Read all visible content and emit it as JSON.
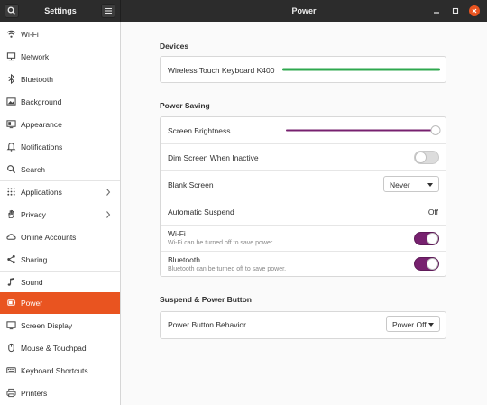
{
  "header": {
    "sidebar_title": "Settings",
    "main_title": "Power",
    "accent_close": "#e95420"
  },
  "sidebar": {
    "active": "Power",
    "active_color": "#e95420",
    "items": [
      {
        "label": "Wi-Fi",
        "icon": "wifi-icon"
      },
      {
        "label": "Network",
        "icon": "network-icon"
      },
      {
        "label": "Bluetooth",
        "icon": "bluetooth-icon"
      },
      {
        "label": "Background",
        "icon": "background-icon"
      },
      {
        "label": "Appearance",
        "icon": "appearance-icon"
      },
      {
        "label": "Notifications",
        "icon": "bell-icon"
      },
      {
        "label": "Search",
        "icon": "search-icon"
      },
      {
        "label": "Applications",
        "icon": "apps-icon",
        "chevron": true
      },
      {
        "label": "Privacy",
        "icon": "hand-icon",
        "chevron": true
      },
      {
        "label": "Online Accounts",
        "icon": "cloud-icon"
      },
      {
        "label": "Sharing",
        "icon": "share-icon"
      },
      {
        "label": "Sound",
        "icon": "music-icon"
      },
      {
        "label": "Power",
        "icon": "power-icon"
      },
      {
        "label": "Screen Display",
        "icon": "display-icon"
      },
      {
        "label": "Mouse & Touchpad",
        "icon": "mouse-icon"
      },
      {
        "label": "Keyboard Shortcuts",
        "icon": "keyboard-icon"
      },
      {
        "label": "Printers",
        "icon": "printer-icon"
      }
    ]
  },
  "devices": {
    "title": "Devices",
    "device_name": "Wireless Touch Keyboard K400",
    "battery_level": 1.0,
    "battery_color": "#2fa84f"
  },
  "power_saving": {
    "title": "Power Saving",
    "screen_brightness": {
      "label": "Screen Brightness",
      "level": 1.0,
      "color": "#77216f"
    },
    "dim_screen": {
      "label": "Dim Screen When Inactive",
      "on": false
    },
    "blank_screen": {
      "label": "Blank Screen",
      "value": "Never"
    },
    "automatic_suspend": {
      "label": "Automatic Suspend",
      "value": "Off"
    },
    "wifi": {
      "label": "Wi-Fi",
      "sublabel": "Wi-Fi can be turned off to save power.",
      "on": true
    },
    "bluetooth": {
      "label": "Bluetooth",
      "sublabel": "Bluetooth can be turned off to save power.",
      "on": true
    },
    "toggle_on_color": "#77216f"
  },
  "suspend": {
    "title": "Suspend & Power Button",
    "power_button": {
      "label": "Power Button Behavior",
      "value": "Power Off"
    }
  }
}
